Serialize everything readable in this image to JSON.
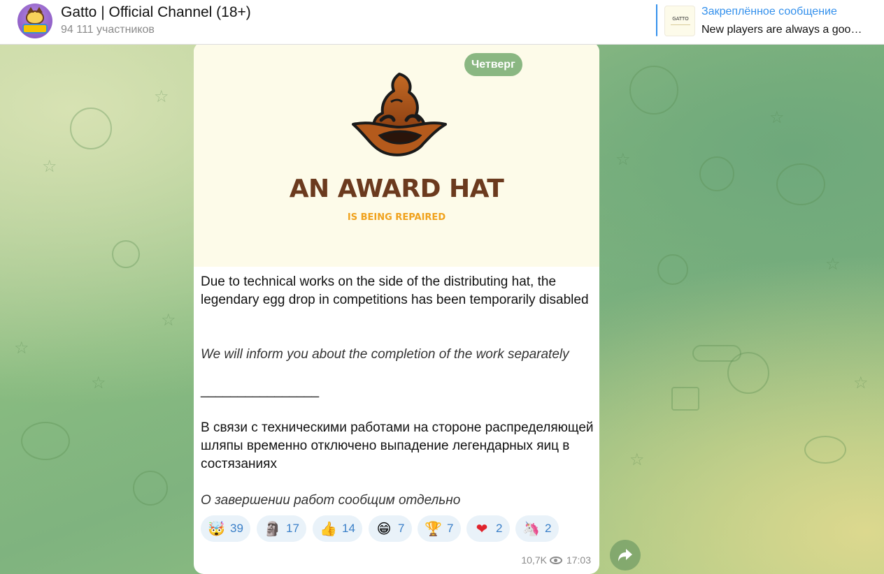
{
  "header": {
    "title": "Gatto | Official Channel (18+)",
    "subscribers": "94 111 участников",
    "avatar_icon": "gatto-cat-logo-icon"
  },
  "pinned": {
    "label": "Закреплённое сообщение",
    "text": "New players are always a goo…",
    "thumb_text": "GATTO"
  },
  "post": {
    "date_label": "Четверг",
    "image": {
      "title": "AN AWARD HAT",
      "subtitle": "IS BEING REPAIRED",
      "icon": "sorting-hat-icon"
    },
    "paragraph_en": "Due to technical works on the side of the distributing hat, the legendary egg drop in competitions has been temporarily disabled",
    "note_en": "We will inform you about the completion of the work separately",
    "separator": "________________",
    "paragraph_ru": "В связи с техническими работами на стороне распределяющей шляпы временно отключено выпадение легендарных яиц в состязаниях",
    "note_ru": "О завершении работ сообщим отдельно",
    "reactions": [
      {
        "emoji": "🤯",
        "count": "39",
        "icon": "exploding-head-icon"
      },
      {
        "emoji": "🗿",
        "count": "17",
        "icon": "moai-icon"
      },
      {
        "emoji": "👍",
        "count": "14",
        "icon": "thumbs-up-icon"
      },
      {
        "emoji": "😁",
        "count": "7",
        "icon": "grinning-face-icon"
      },
      {
        "emoji": "🏆",
        "count": "7",
        "icon": "trophy-icon"
      },
      {
        "emoji": "❤",
        "count": "2",
        "icon": "heart-icon"
      },
      {
        "emoji": "🦄",
        "count": "2",
        "icon": "unicorn-icon"
      }
    ],
    "views": "10,7K",
    "time": "17:03"
  },
  "colors": {
    "accent": "#3390ec",
    "reaction_bg": "#e9f2f9",
    "award_title": "#6b3a1e",
    "award_subtitle": "#f0a21d"
  }
}
